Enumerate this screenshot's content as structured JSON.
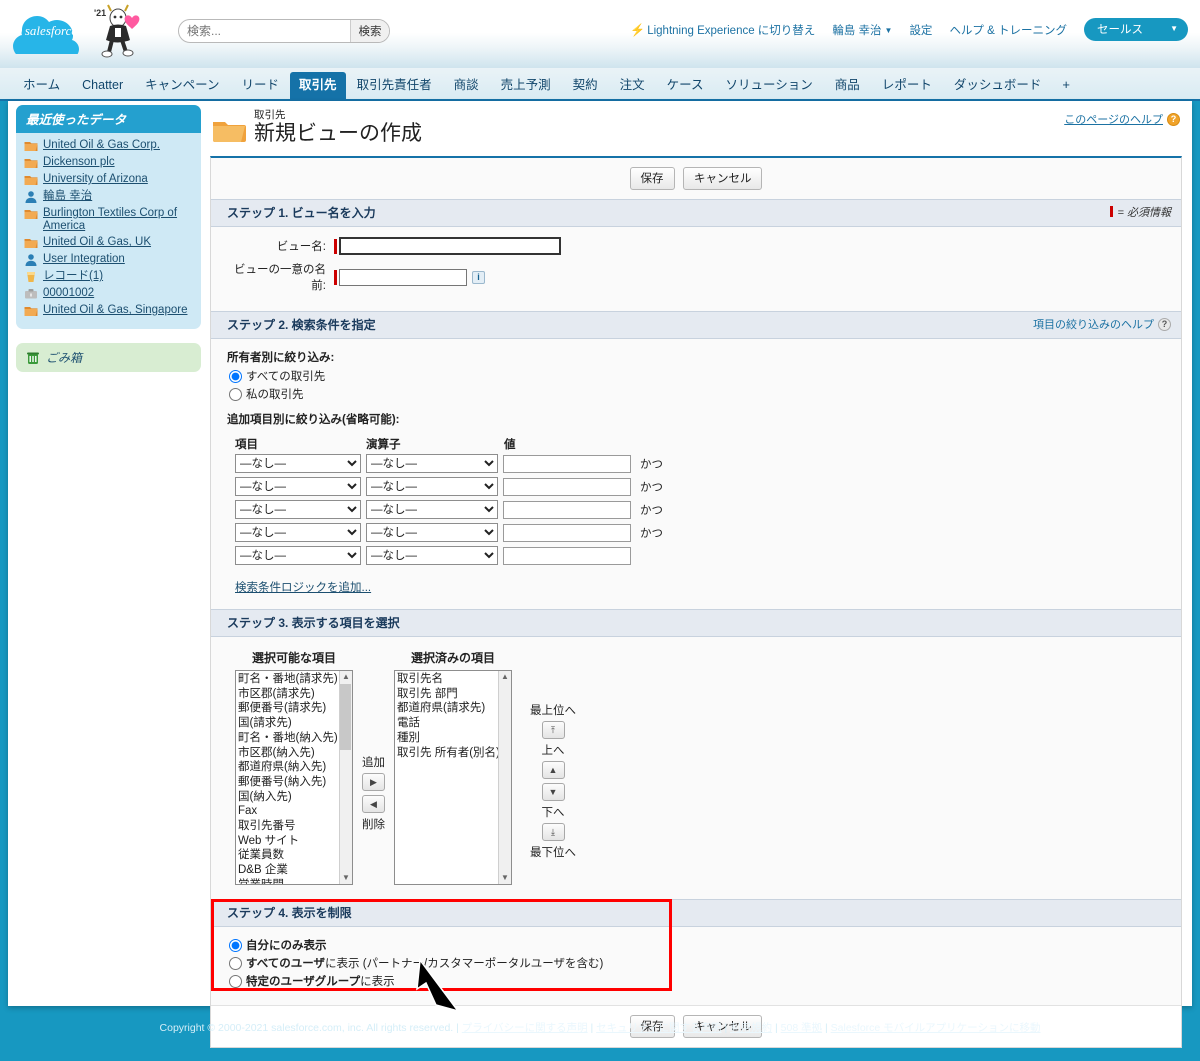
{
  "header": {
    "logo_text": "salesforce",
    "mascot_year": "'21",
    "search": {
      "placeholder": "検索...",
      "value": "",
      "button_label": "検索"
    },
    "lightning_link": "Lightning Experience に切り替え",
    "user_name": "輪島 幸治",
    "setup_link": "設定",
    "help_link": "ヘルプ & トレーニング",
    "app_picker": "セールス"
  },
  "tabs": [
    {
      "label": "ホーム",
      "active": false
    },
    {
      "label": "Chatter",
      "active": false
    },
    {
      "label": "キャンペーン",
      "active": false
    },
    {
      "label": "リード",
      "active": false
    },
    {
      "label": "取引先",
      "active": true
    },
    {
      "label": "取引先責任者",
      "active": false
    },
    {
      "label": "商談",
      "active": false
    },
    {
      "label": "売上予測",
      "active": false
    },
    {
      "label": "契約",
      "active": false
    },
    {
      "label": "注文",
      "active": false
    },
    {
      "label": "ケース",
      "active": false
    },
    {
      "label": "ソリューション",
      "active": false
    },
    {
      "label": "商品",
      "active": false
    },
    {
      "label": "レポート",
      "active": false
    },
    {
      "label": "ダッシュボード",
      "active": false
    }
  ],
  "tab_plus": "+",
  "sidebar": {
    "recent_title": "最近使ったデータ",
    "recent_items": [
      {
        "label": "United Oil & Gas Corp.",
        "icon": "account-icon"
      },
      {
        "label": "Dickenson plc",
        "icon": "account-icon"
      },
      {
        "label": "University of Arizona",
        "icon": "account-icon"
      },
      {
        "label": "輪島 幸治",
        "icon": "user-icon"
      },
      {
        "label": "Burlington Textiles Corp of America",
        "icon": "account-icon"
      },
      {
        "label": "United Oil & Gas, UK",
        "icon": "account-icon"
      },
      {
        "label": "User Integration",
        "icon": "user-icon"
      },
      {
        "label": "レコード(1)",
        "icon": "report-icon"
      },
      {
        "label": "00001002",
        "icon": "case-icon"
      },
      {
        "label": "United Oil & Gas, Singapore",
        "icon": "account-icon"
      }
    ],
    "recycle_bin": "ごみ箱"
  },
  "main": {
    "breadcrumb": "取引先",
    "title": "新規ビューの作成",
    "page_help": "このページのヘルプ",
    "save_label": "保存",
    "cancel_label": "キャンセル",
    "required_note": "= 必須情報",
    "step1": {
      "header": "ステップ 1. ビュー名を入力",
      "view_name_label": "ビュー名:",
      "view_name_value": "",
      "unique_name_label": "ビューの一意の名前:",
      "unique_name_value": ""
    },
    "step2": {
      "header": "ステップ 2. 検索条件を指定",
      "filter_help": "項目の絞り込みのヘルプ",
      "owner_label": "所有者別に絞り込み:",
      "owner_options": [
        {
          "label": "すべての取引先",
          "checked": true
        },
        {
          "label": "私の取引先",
          "checked": false
        }
      ],
      "additional_label": "追加項目別に絞り込み(省略可能):",
      "col_field": "項目",
      "col_operator": "演算子",
      "col_value": "値",
      "none_option": "—なし—",
      "and_label": "かつ",
      "rows": [
        {
          "field": "—なし—",
          "operator": "—なし—",
          "value": "",
          "and": true
        },
        {
          "field": "—なし—",
          "operator": "—なし—",
          "value": "",
          "and": true
        },
        {
          "field": "—なし—",
          "operator": "—なし—",
          "value": "",
          "and": true
        },
        {
          "field": "—なし—",
          "operator": "—なし—",
          "value": "",
          "and": true
        },
        {
          "field": "—なし—",
          "operator": "—なし—",
          "value": "",
          "and": false
        }
      ],
      "add_logic_link": "検索条件ロジックを追加..."
    },
    "step3": {
      "header": "ステップ 3. 表示する項目を選択",
      "available_title": "選択可能な項目",
      "selected_title": "選択済みの項目",
      "add_label": "追加",
      "remove_label": "削除",
      "top_label": "最上位へ",
      "up_label": "上へ",
      "down_label": "下へ",
      "bottom_label": "最下位へ",
      "available_fields": [
        "町名・番地(請求先)",
        "市区郡(請求先)",
        "郵便番号(請求先)",
        "国(請求先)",
        "町名・番地(納入先)",
        "市区郡(納入先)",
        "都道府県(納入先)",
        "郵便番号(納入先)",
        "国(納入先)",
        "Fax",
        "取引先番号",
        "Web サイト",
        "従業員数",
        "D&B 企業",
        "営業時間"
      ],
      "selected_fields": [
        "取引先名",
        "取引先 部門",
        "都道府県(請求先)",
        "電話",
        "種別",
        "取引先 所有者(別名)"
      ]
    },
    "step4": {
      "header": "ステップ 4. 表示を制限",
      "options": [
        {
          "label": "自分にのみ表示",
          "checked": true,
          "bold": false
        },
        {
          "label_bold": "すべてのユーザ",
          "label_rest": "に表示 (パートナー/カスタマーポータルユーザを含む)",
          "checked": false
        },
        {
          "label_bold": "特定のユーザグループ",
          "label_rest": "に表示",
          "checked": false
        }
      ]
    }
  },
  "footer": {
    "copyright": "Copyright © 2000-2021 salesforce.com, inc. All rights reserved. | ",
    "links": [
      "プライバシーに関する声明",
      "セキュリティに関する声明",
      "利用規約",
      "508 準拠",
      "Salesforce モバイルアプリケーションに移動"
    ],
    "sep": " | "
  },
  "colors": {
    "accent": "#1798c1",
    "tab_active": "#1572a8",
    "highlight_red": "#ff0000"
  }
}
